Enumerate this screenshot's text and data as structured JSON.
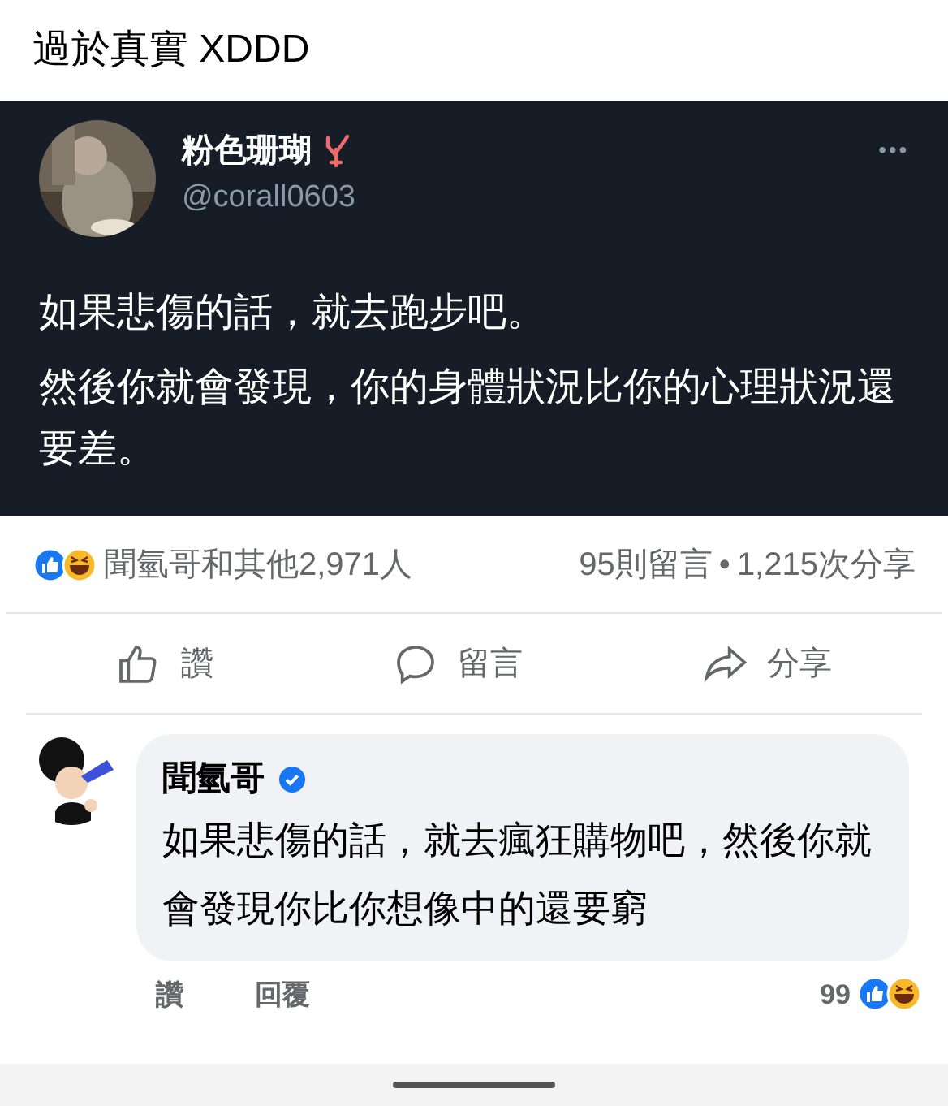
{
  "post": {
    "text": "過於真實 XDDD"
  },
  "tweet": {
    "name": "粉色珊瑚",
    "handle": "@corall0603",
    "more": "•••",
    "lines": [
      "如果悲傷的話，就去跑步吧。",
      "然後你就會發現，你的身體狀況比你的心理狀況還要差。"
    ]
  },
  "stats": {
    "reactions": "聞氫哥和其他2,971人",
    "comments": "95則留言",
    "separator": "•",
    "shares": "1,215次分享"
  },
  "actions": [
    {
      "kind": "like",
      "label": "讚"
    },
    {
      "kind": "comment",
      "label": "留言"
    },
    {
      "kind": "share",
      "label": "分享"
    }
  ],
  "comment": {
    "author": "聞氫哥",
    "verified": true,
    "text": "如果悲傷的話，就去瘋狂購物吧，然後你就會發現你比你想像中的還要窮",
    "actions": [
      "讚",
      "回覆"
    ],
    "reaction_count": "99"
  }
}
